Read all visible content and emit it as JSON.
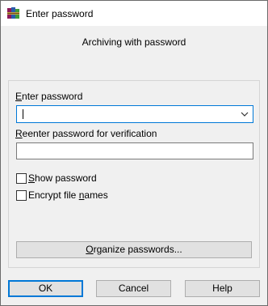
{
  "window": {
    "title": "Enter password",
    "subtitle": "Archiving with password"
  },
  "icons": {
    "app": "winrar-books-icon",
    "dropdown": "chevron-down-icon"
  },
  "form": {
    "enter_label_u": "E",
    "enter_label_rest": "nter password",
    "enter_value": "",
    "reenter_label_u": "R",
    "reenter_label_rest": "eenter password for verification",
    "reenter_value": "",
    "show_password_u": "S",
    "show_password_rest": "how password",
    "show_password_checked": false,
    "encrypt_pre": "Encrypt file ",
    "encrypt_u": "n",
    "encrypt_rest": "ames",
    "encrypt_checked": false,
    "organize_u": "O",
    "organize_rest": "rganize passwords..."
  },
  "buttons": {
    "ok": "OK",
    "cancel": "Cancel",
    "help": "Help"
  },
  "colors": {
    "focus": "#0078d7",
    "dialog_bg": "#f0f0f0"
  }
}
